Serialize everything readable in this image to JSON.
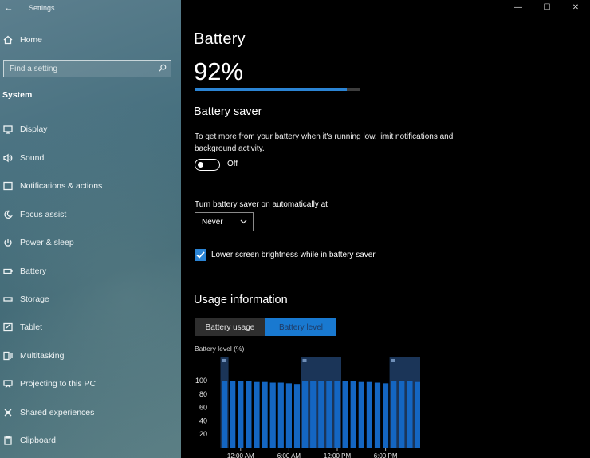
{
  "window": {
    "title": "Settings",
    "minimize": "—",
    "maximize": "☐",
    "close": "✕"
  },
  "sidebar": {
    "home": "Home",
    "search_placeholder": "Find a setting",
    "section": "System",
    "items": [
      {
        "label": "Display",
        "icon": "display-icon"
      },
      {
        "label": "Sound",
        "icon": "sound-icon"
      },
      {
        "label": "Notifications & actions",
        "icon": "notifications-icon"
      },
      {
        "label": "Focus assist",
        "icon": "focus-assist-icon"
      },
      {
        "label": "Power & sleep",
        "icon": "power-icon"
      },
      {
        "label": "Battery",
        "icon": "battery-icon"
      },
      {
        "label": "Storage",
        "icon": "storage-icon"
      },
      {
        "label": "Tablet",
        "icon": "tablet-icon"
      },
      {
        "label": "Multitasking",
        "icon": "multitasking-icon"
      },
      {
        "label": "Projecting to this PC",
        "icon": "projecting-icon"
      },
      {
        "label": "Shared experiences",
        "icon": "shared-icon"
      },
      {
        "label": "Clipboard",
        "icon": "clipboard-icon"
      }
    ]
  },
  "main": {
    "title": "Battery",
    "percent_text": "92%",
    "percent_value": 92,
    "battery_saver": {
      "heading": "Battery saver",
      "description": "To get more from your battery when it's running low, limit notifications and background activity.",
      "toggle_state": "Off",
      "auto_label": "Turn battery saver on automatically at",
      "auto_value": "Never",
      "brightness_label": "Lower screen brightness while in battery saver",
      "brightness_checked": true
    },
    "usage": {
      "heading": "Usage information",
      "tabs": [
        {
          "label": "Battery usage",
          "selected": false
        },
        {
          "label": "Battery level",
          "selected": true
        }
      ]
    }
  },
  "colors": {
    "accent": "#1979d0",
    "bar_fill": "#2b84d4",
    "chart_bar": "#1466c2",
    "band": "#1b3558"
  },
  "chart_data": {
    "type": "bar",
    "title": "Battery level (%)",
    "ylim": [
      0,
      100
    ],
    "y_ticks": [
      100,
      80,
      60,
      40,
      20
    ],
    "x_tick_labels": [
      "12:00 AM",
      "6:00 AM",
      "12:00 PM",
      "6:00 PM"
    ],
    "values": [
      100,
      100,
      99,
      99,
      98,
      98,
      97,
      97,
      96,
      95,
      100,
      100,
      100,
      100,
      100,
      99,
      99,
      98,
      98,
      97,
      96,
      100,
      100,
      99,
      98,
      93
    ],
    "charging_bands": [
      [
        0,
        1
      ],
      [
        10,
        15
      ],
      [
        21,
        25
      ]
    ]
  }
}
